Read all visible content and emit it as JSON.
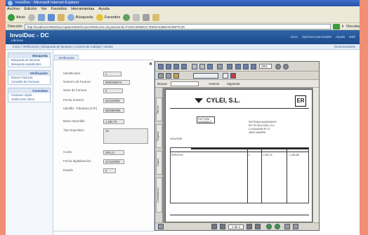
{
  "browser": {
    "title": "InvoiDoc - Microsoft Internet Explorer",
    "menu": [
      "Archivo",
      "Edición",
      "Ver",
      "Favoritos",
      "Herramientas",
      "Ayuda"
    ],
    "toolbar": {
      "back": "Atrás",
      "search": "Búsqueda",
      "favorites": "Favoritos"
    },
    "address_label": "Dirección",
    "address": "http://localhost:8082/DocCaptureWeb/Invoice/Welcome.do;jsessionid=FCD4CEB6E1C7EEDA4485C9C95FFL36",
    "go_label": "Ir",
    "links_label": "Vínculos"
  },
  "app": {
    "brand": "InvoiDoc - DC",
    "brand_sub": "Lâminas",
    "header_links": [
      "Inicio",
      "Opciones personales",
      "Ayuda",
      "Salir"
    ],
    "breadcrumb": "Inicio | Verificación | Búsqueda de facturas | Control de Calidad | Visado",
    "breadcrumb_exit": "Desconectarse"
  },
  "sidebar": {
    "sections": [
      {
        "title": "Búsqueda",
        "items": [
          "Búsqueda de facturas",
          "Búsqueda expedientes"
        ]
      },
      {
        "title": "Verificación",
        "items": [
          "Buscar Facturas",
          "Consulta de Facturas"
        ]
      },
      {
        "title": "Consultas",
        "items": [
          "Facturas Lloyds",
          "Verificación Otros"
        ]
      }
    ]
  },
  "form": {
    "tab_label": "Verificación",
    "fields": [
      {
        "label": "Identificador",
        "value": "1"
      },
      {
        "label": "Número de Factura",
        "value": "0000469072"
      },
      {
        "label": "Serie de Factura",
        "value": "0"
      },
      {
        "label": "Fecha emisión",
        "value": "04/11/2005"
      },
      {
        "label": "Identific. Tributaria (CIF)",
        "value": "B02960386"
      },
      {
        "label": "Base imponible",
        "value": "1.250,76"
      },
      {
        "label": "Tipo impositivo",
        "value": "16"
      },
      {
        "label": "Cuota",
        "value": "200,12"
      },
      {
        "label": "Fecha digitalización",
        "value": "21/11/2005"
      },
      {
        "label": "Estado",
        "value": "0"
      }
    ]
  },
  "viewer": {
    "zoom": "29%",
    "find_label": "Buscar",
    "prev_label": "Anterior",
    "next_label": "Siguiente",
    "side_tabs": [
      "Firmas",
      "Páginas",
      "Capas",
      "Comentarios"
    ],
    "page": "1 de 1",
    "document": {
      "company": "CYLEI, S.L.",
      "badge": "ER",
      "customer_lines": [
        "SISTEMAS AVANZADOS",
        "DE TECNOLOGÍA, S.A.",
        "C/ ALMAZÁN Nº 12",
        "28022 MADRID"
      ],
      "invoice_label": "FACTURA",
      "invoice_number": "0000469072",
      "date": "04/11/2005",
      "item": "SERVICIO",
      "total": "1.450,88",
      "qty": "1",
      "price": "1.250,76"
    }
  },
  "colors": {
    "background_strip": "#f08f74",
    "header_blue": "#1b4a8a",
    "viewer_gray": "#8b8b8b"
  }
}
